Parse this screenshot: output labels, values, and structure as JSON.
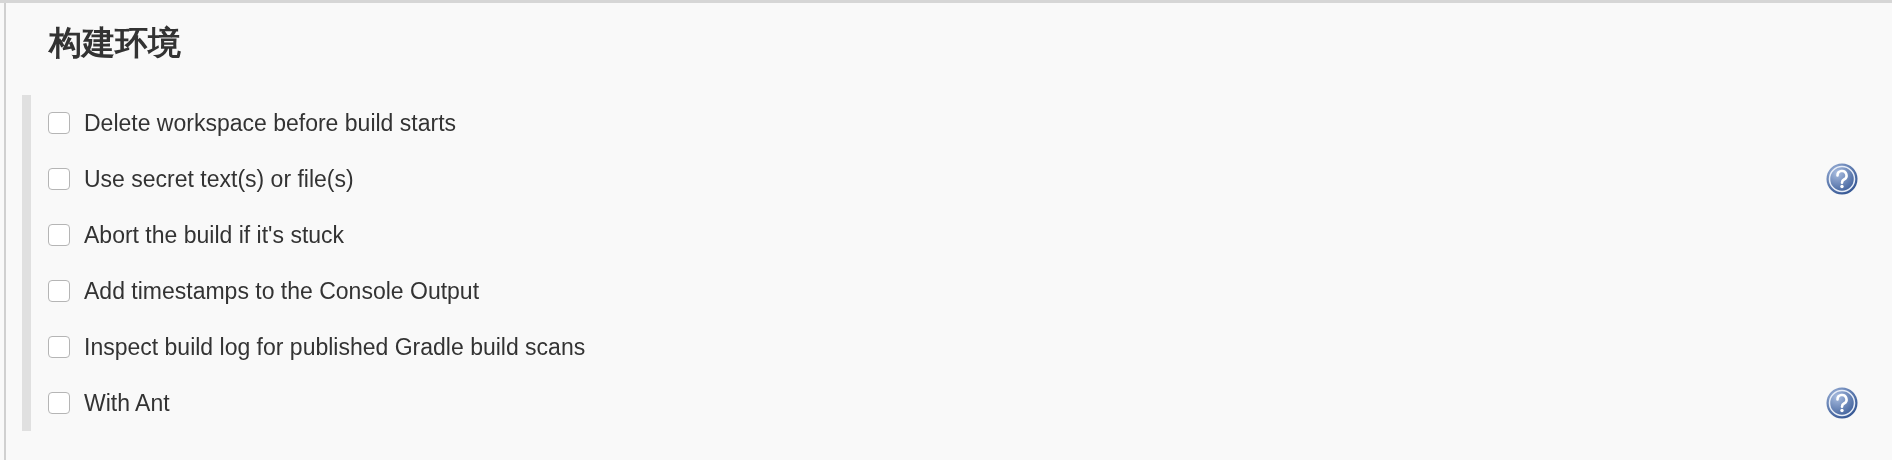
{
  "section": {
    "title": "构建环境"
  },
  "options": [
    {
      "label": "Delete workspace before build starts",
      "checked": false,
      "help": false
    },
    {
      "label": "Use secret text(s) or file(s)",
      "checked": false,
      "help": true
    },
    {
      "label": "Abort the build if it's stuck",
      "checked": false,
      "help": false
    },
    {
      "label": "Add timestamps to the Console Output",
      "checked": false,
      "help": false
    },
    {
      "label": "Inspect build log for published Gradle build scans",
      "checked": false,
      "help": false
    },
    {
      "label": "With Ant",
      "checked": false,
      "help": true
    }
  ]
}
